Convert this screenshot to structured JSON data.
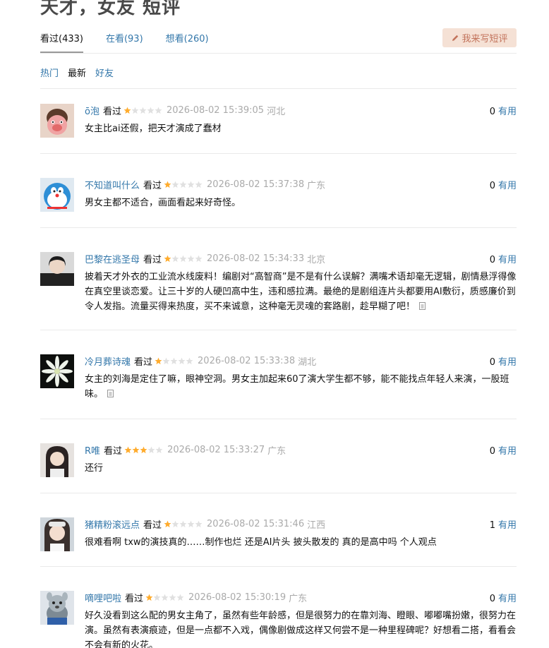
{
  "page": {
    "title": "天才，女友 短评"
  },
  "tabs": [
    {
      "label": "看过(433)"
    },
    {
      "label": "在看(93)"
    },
    {
      "label": "想看(260)"
    }
  ],
  "write_button": {
    "label": "我来写短评",
    "icon": "pencil-icon"
  },
  "sort": [
    {
      "label": "热门"
    },
    {
      "label": "最新"
    },
    {
      "label": "好友"
    }
  ],
  "comments": [
    {
      "user": "ō泡",
      "status": "看过",
      "rating": 1,
      "time": "2026-08-02 15:39:05",
      "location": "河北",
      "votes": "0",
      "vote_label": "有用",
      "text": "女主比ai还假，把天才演成了蠢材"
    },
    {
      "user": "不知道叫什么",
      "status": "看过",
      "rating": 1,
      "time": "2026-08-02 15:37:38",
      "location": "广东",
      "votes": "0",
      "vote_label": "有用",
      "text": "男女主都不适合，画面看起来好奇怪。"
    },
    {
      "user": "巴黎在逃圣母",
      "status": "看过",
      "rating": 1,
      "time": "2026-08-02 15:34:33",
      "location": "北京",
      "votes": "0",
      "vote_label": "有用",
      "text": "披着天才外衣的工业流水线废料！编剧对“高智商”是不是有什么误解？满嘴术语却毫无逻辑，剧情悬浮得像在真空里谈恋爱。让三十岁的人硬凹高中生，违和感拉满。最绝的是剧组连片头都要用AI敷衍，质感廉价到令人发指。流量买得来热度，买不来诚意，这种毫无灵魂的套路剧，趁早糊了吧！"
    },
    {
      "user": "冷月葬诗魂",
      "status": "看过",
      "rating": 1,
      "time": "2026-08-02 15:33:38",
      "location": "湖北",
      "votes": "0",
      "vote_label": "有用",
      "text": "女主的刘海是定住了嘛，眼神空洞。男女主加起来60了演大学生都不够，能不能找点年轻人来演，一股班味。"
    },
    {
      "user": "R唯",
      "status": "看过",
      "rating": 3,
      "time": "2026-08-02 15:33:27",
      "location": "广东",
      "votes": "0",
      "vote_label": "有用",
      "text": "还行"
    },
    {
      "user": "猪精粉滚远点",
      "status": "看过",
      "rating": 1,
      "time": "2026-08-02 15:31:46",
      "location": "江西",
      "votes": "1",
      "vote_label": "有用",
      "text": "很难看啊 txw的演技真的……制作也烂 还是AI片头 披头散发的 真的是高中吗 个人观点"
    },
    {
      "user": "嘀哩吧啦",
      "status": "看过",
      "rating": 1,
      "time": "2026-08-02 15:30:19",
      "location": "广东",
      "votes": "0",
      "vote_label": "有用",
      "text": "好久没看到这么配的男女主角了，虽然有些年龄感，但是很努力的在靠刘海、瞪眼、嘟嘟嘴扮嫩，很努力在演。虽然有表演痕迹，但是一点都不入戏，偶像剧做成这样又何尝不是一种里程碑呢？好想看二搭，看看会不会有新的火花。"
    }
  ],
  "colors": {
    "link": "#3377aa",
    "meta": "#aaaaaa",
    "star": "#ffac2d",
    "star_empty": "#e0e0e0",
    "button_bg": "#f5e1d5",
    "button_text": "#c2735b"
  }
}
